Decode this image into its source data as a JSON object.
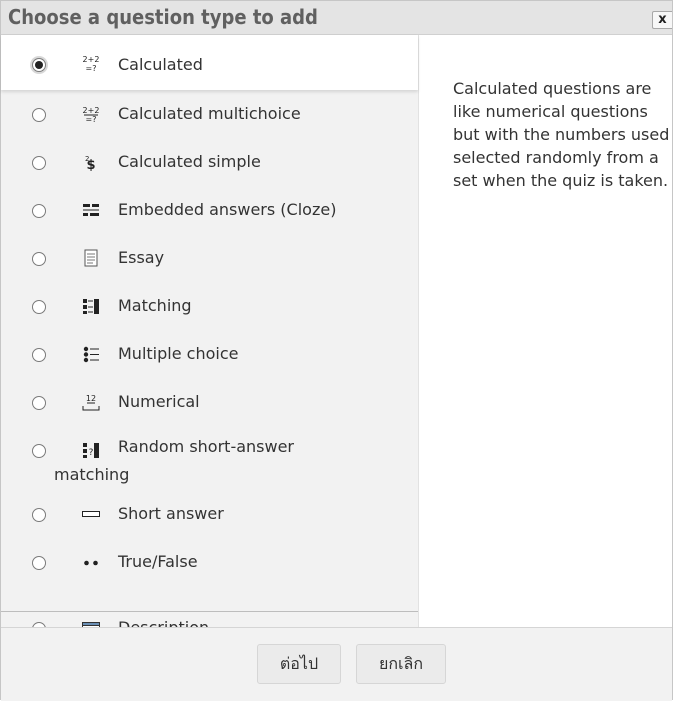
{
  "dialog": {
    "title": "Choose a question type to add",
    "close_label": "x"
  },
  "options": [
    {
      "label": "Calculated",
      "icon": "calculated-icon",
      "selected": true
    },
    {
      "label": "Calculated multichoice",
      "icon": "calculated-multichoice-icon",
      "selected": false
    },
    {
      "label": "Calculated simple",
      "icon": "calculated-simple-icon",
      "selected": false
    },
    {
      "label": "Embedded answers (Cloze)",
      "icon": "cloze-icon",
      "selected": false
    },
    {
      "label": "Essay",
      "icon": "essay-icon",
      "selected": false
    },
    {
      "label": "Matching",
      "icon": "matching-icon",
      "selected": false
    },
    {
      "label": "Multiple choice",
      "icon": "multiple-choice-icon",
      "selected": false
    },
    {
      "label": "Numerical",
      "icon": "numerical-icon",
      "selected": false
    },
    {
      "label": "Random short-answer matching",
      "icon": "random-short-answer-matching-icon",
      "selected": false
    },
    {
      "label": "Short answer",
      "icon": "short-answer-icon",
      "selected": false
    },
    {
      "label": "True/False",
      "icon": "true-false-icon",
      "selected": false
    },
    {
      "label": "Description",
      "icon": "description-icon",
      "selected": false
    }
  ],
  "description": "Calculated questions are like numerical questions but with the numbers used selected randomly from a set when the quiz is taken.",
  "footer": {
    "next_label": "ต่อไป",
    "cancel_label": "ยกเลิก"
  }
}
